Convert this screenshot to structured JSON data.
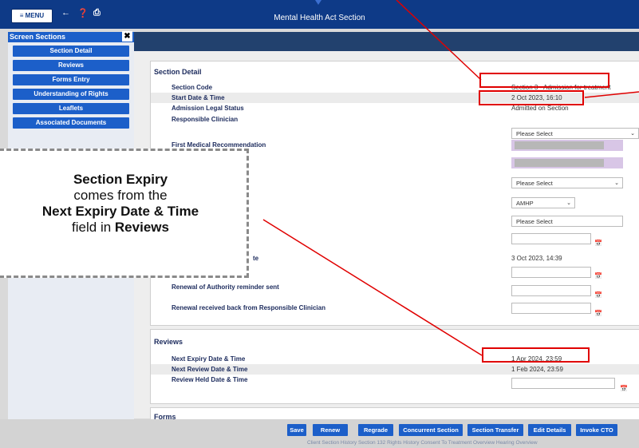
{
  "topbar": {
    "menu_label": "≡ MENU",
    "title": "Mental Health Act Section"
  },
  "sidebar": {
    "header": "Screen Sections",
    "close": "✖",
    "items": [
      "Section Detail",
      "Reviews",
      "Forms Entry",
      "Understanding of Rights",
      "Leaflets",
      "Associated Documents"
    ]
  },
  "section_detail": {
    "heading": "Section Detail",
    "section_code_label": "Section Code",
    "section_code_value": "Section 3 - Admission for treatment",
    "start_label": "Start Date & Time",
    "start_value": "2 Oct 2023, 16:10",
    "admission_status_label": "Admission Legal Status",
    "admission_status_value": "Admitted on Section",
    "responsible_clinician_label": "Responsible Clinician",
    "please_select": "Please Select",
    "first_medical_label": "First Medical Recommendation",
    "second_medical_partial": "ndation",
    "amhp_value": "AMHP",
    "date_partial_label": "te",
    "date_value": "3 Oct 2023, 14:39",
    "renewal_reminder_label": "Renewal of Authority reminder sent",
    "renewal_received_label": "Renewal received back from Responsible Clinician"
  },
  "reviews": {
    "heading": "Reviews",
    "next_expiry_label": "Next Expiry Date & Time",
    "next_expiry_value": "1 Apr 2024, 23:59",
    "next_review_label": "Next Review Date & Time",
    "next_review_value": "1 Feb 2024, 23:59",
    "review_held_label": "Review Held Date & Time"
  },
  "forms": {
    "heading": "Forms"
  },
  "buttons": [
    "Save",
    "Renew",
    "Regrade",
    "Concurrent Section",
    "Section Transfer",
    "Edit Details",
    "Invoke CTO"
  ],
  "bottom_links": "Client Section History  Section 132 Rights History  Consent To Treatment Overview  Hearing Overview",
  "callout": {
    "title": "Section Expiry",
    "line2": "comes from the",
    "line3_bold": "Next Expiry Date & Time",
    "line4_pre": "field in ",
    "line4_bold": "Reviews"
  },
  "colors": {
    "topbar": "#0e3a87",
    "button": "#1c5fc9",
    "highlight": "#e00000"
  }
}
